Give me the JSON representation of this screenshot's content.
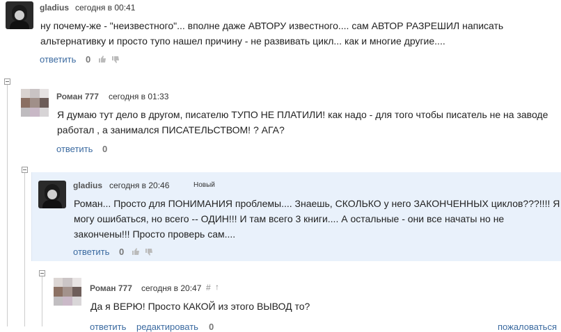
{
  "comments": [
    {
      "author": "gladius",
      "time": "сегодня в 00:41",
      "text_lines": [
        "ну почему-же - \"неизвестного\"... вполне даже  АВТОРУ известного.... сам АВТОР РАЗРЕШИЛ написать",
        "альтернативку и просто тупо нашел причину - не развивать цикл... как и многие другие...."
      ],
      "reply": "ответить",
      "score": "0"
    },
    {
      "author": "Роман 777",
      "time": "сегодня в 01:33",
      "text_lines": [
        "Я думаю тут дело в другом, писателю ТУПО НЕ ПЛАТИЛИ! как надо - для того чтобы писатель не на заводе",
        "работал , а занимался ПИСАТЕЛЬСТВОМ! ? АГА?"
      ],
      "reply": "ответить",
      "score": "0"
    },
    {
      "author": "gladius",
      "time": "сегодня в 20:46",
      "badge": "Новый",
      "text_lines": [
        "Роман... Просто для ПОНИМАНИЯ проблемы.... Знаешь, СКОЛЬКО у него ЗАКОНЧЕННЫХ циклов???!!!!  Я",
        "могу ошибаться, но всего -- ОДИН!!!  И там всего 3 книги.... А остальные - они все начаты но не",
        "закончены!!!  Просто проверь сам...."
      ],
      "reply": "ответить",
      "score": "0"
    },
    {
      "author": "Роман 777",
      "time": "сегодня в 20:47",
      "hash": "#",
      "up": "↑",
      "text_lines": [
        "Да я ВЕРЮ! Просто КАКОЙ из этого ВЫВОД то?"
      ],
      "reply": "ответить",
      "edit": "редактировать",
      "score": "0",
      "complain": "пожаловаться"
    }
  ],
  "colors": {
    "link": "#3b6aa0",
    "highlight": "#e9f1fb"
  }
}
